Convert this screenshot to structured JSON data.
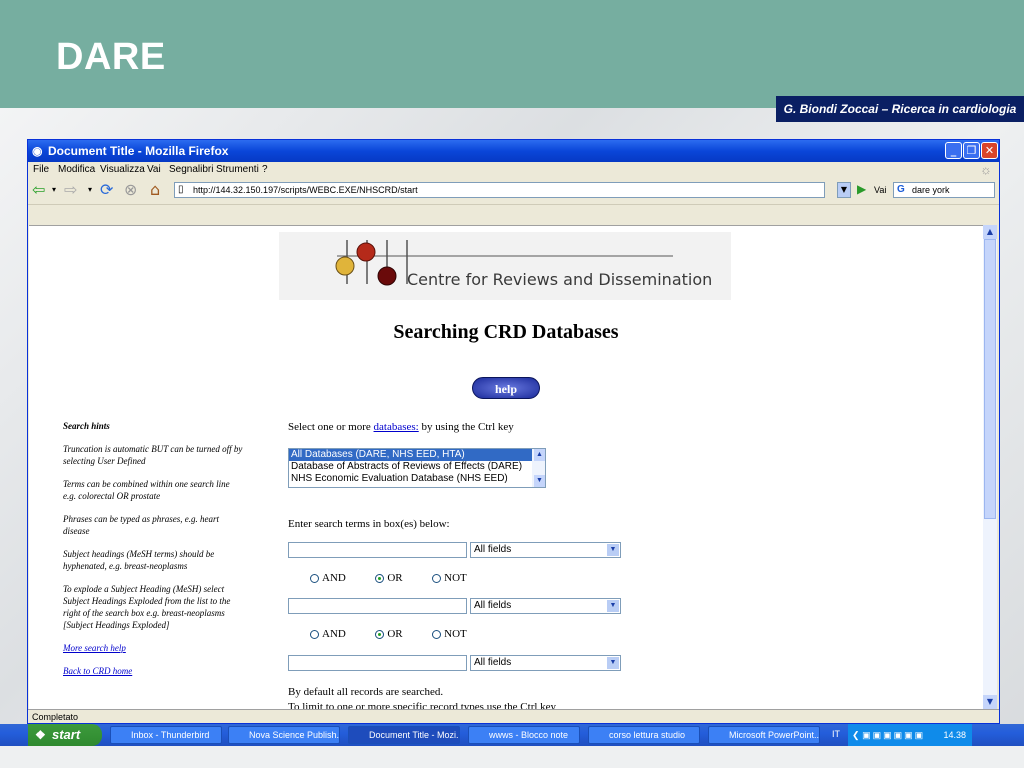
{
  "slide": {
    "title": "DARE",
    "author": "G. Biondi Zoccai – Ricerca in cardiologia"
  },
  "browser": {
    "window_title": "Document Title - Mozilla Firefox",
    "menu": [
      "File",
      "Modifica",
      "Visualizza",
      "Vai",
      "Segnalibri",
      "Strumenti",
      "?"
    ],
    "url": "http://144.32.150.197/scripts/WEBC.EXE/NHSCRD/start",
    "go_label": "Vai",
    "search_value": "dare york",
    "status": "Completato"
  },
  "page": {
    "logo_text": "Centre for Reviews and Dissemination",
    "heading": "Searching CRD Databases",
    "help_label": "help",
    "hints": {
      "title": "Search hints",
      "items": [
        "Truncation is automatic BUT can be turned off by selecting User Defined",
        "Terms can be combined within one search line e.g. colorectal OR prostate",
        "Phrases can be typed as phrases, e.g. heart disease",
        "Subject headings (MeSH terms) should be hyphenated, e.g. breast-neoplasms",
        "To explode a Subject Heading (MeSH) select Subject Headings Exploded from the list to the right of the search box e.g. breast-neoplasms [Subject Headings Exploded]"
      ],
      "link_more": "More search help",
      "link_back": "Back to CRD home"
    },
    "select_prompt_before": "Select one or more ",
    "select_prompt_link": "databases:",
    "select_prompt_after": " by using the Ctrl key",
    "databases": [
      "All Databases (DARE, NHS EED, HTA)",
      "Database of Abstracts of Reviews of Effects (DARE)",
      "NHS Economic Evaluation Database (NHS EED)"
    ],
    "enter_terms": "Enter search terms in box(es) below:",
    "field_option": "All fields",
    "operators": [
      "AND",
      "OR",
      "NOT"
    ],
    "selected_operator": "OR",
    "default_note": "By default all records are searched.",
    "limit_note": "To limit to one or more specific record types use the Ctrl key"
  },
  "taskbar": {
    "start": "start",
    "tasks": [
      "Inbox - Thunderbird",
      "Nova Science Publish...",
      "Document Title - Mozi...",
      "wwws - Blocco note",
      "corso lettura studio",
      "Microsoft PowerPoint..."
    ],
    "active_task": "Document Title - Mozi...",
    "lang": "IT",
    "clock": "14.38"
  }
}
